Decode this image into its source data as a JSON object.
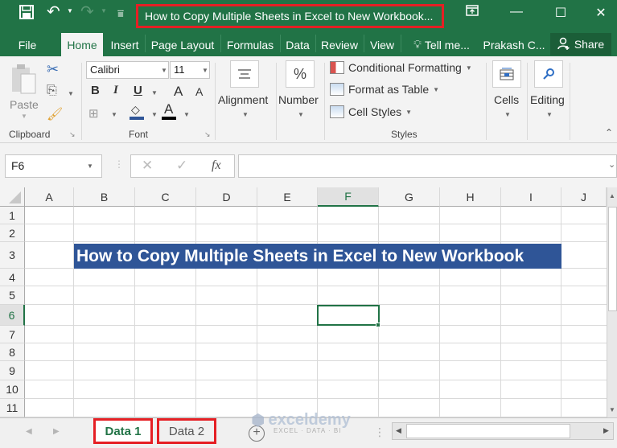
{
  "window": {
    "title": "How to Copy Multiple Sheets in Excel to New Workbook...",
    "qat": {
      "save": "save-icon",
      "undo": "undo-icon",
      "redo": "redo-icon",
      "customize": "customize-qat-icon"
    },
    "controls": {
      "ribbon_display": "ribbon-display-options-icon",
      "minimize": "—",
      "maximize": "☐",
      "close": "✕"
    }
  },
  "ribbon_tabs": [
    "File",
    "Home",
    "Insert",
    "Page Layout",
    "Formulas",
    "Data",
    "Review",
    "View",
    "Tell me...",
    "Prakash C..."
  ],
  "active_tab": "Home",
  "share_label": "Share",
  "ribbon": {
    "clipboard": {
      "paste": "Paste",
      "label": "Clipboard"
    },
    "font": {
      "name": "Calibri",
      "size": "11",
      "bold": "B",
      "italic": "I",
      "underline": "U",
      "grow": "A",
      "shrink": "A",
      "font_color": "A",
      "label": "Font"
    },
    "alignment": {
      "label": "Alignment"
    },
    "number": {
      "label": "Number",
      "icon_text": "%"
    },
    "styles": {
      "conditional": "Conditional Formatting",
      "format_table": "Format as Table",
      "cell_styles": "Cell Styles",
      "label": "Styles"
    },
    "cells": {
      "label": "Cells"
    },
    "editing": {
      "label": "Editing"
    }
  },
  "formula_bar": {
    "name_box": "F6",
    "cancel": "✕",
    "enter": "✓",
    "fx": "fx",
    "formula": ""
  },
  "grid": {
    "columns": [
      "A",
      "B",
      "C",
      "D",
      "E",
      "F",
      "G",
      "H",
      "I",
      "J"
    ],
    "selected_column": "F",
    "rows": [
      "1",
      "2",
      "3",
      "4",
      "5",
      "6",
      "7",
      "8",
      "9",
      "10",
      "11"
    ],
    "selected_row": "6",
    "cells": {
      "B3": "How to Copy Multiple Sheets in Excel to New Workbook"
    },
    "active_cell": "F6"
  },
  "sheets": [
    {
      "name": "Data 1",
      "active": true
    },
    {
      "name": "Data 2",
      "active": false
    }
  ],
  "watermark": {
    "brand": "exceldemy",
    "tagline": "EXCEL · DATA · BI"
  },
  "colors": {
    "excel_green": "#217346",
    "title_fill": "#2f5597",
    "highlight_red": "#e51f24"
  }
}
